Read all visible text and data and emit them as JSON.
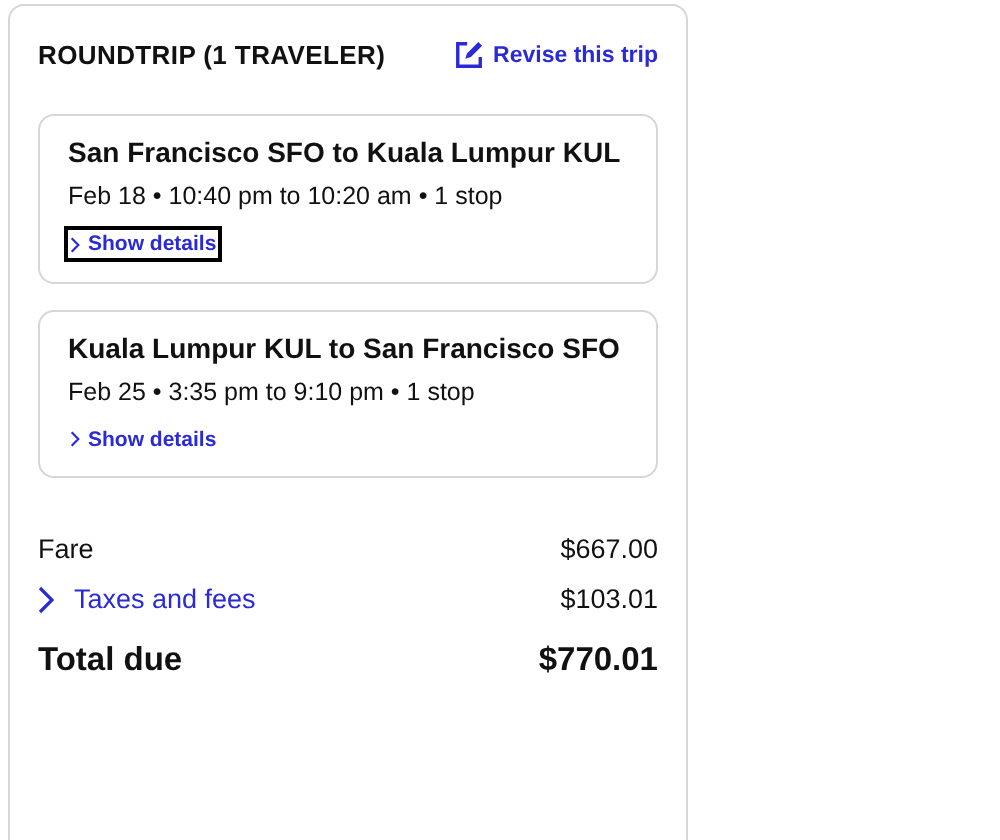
{
  "summary": {
    "title": "ROUNDTRIP (1 TRAVELER)",
    "revise_link": "Revise this trip"
  },
  "flights": [
    {
      "route": "San Francisco SFO to Kuala Lumpur KUL",
      "details": "Feb 18 • 10:40 pm to 10:20 am • 1 stop",
      "toggle": "Show details",
      "focused": true
    },
    {
      "route": "Kuala Lumpur KUL to San Francisco SFO",
      "details": "Feb 25 • 3:35 pm to 9:10 pm • 1 stop",
      "toggle": "Show details",
      "focused": false
    }
  ],
  "price_lines": [
    {
      "kind": "plain",
      "label": "Fare",
      "amount": "$667.00"
    },
    {
      "kind": "expandable",
      "label": "Taxes and fees",
      "amount": "$103.01"
    },
    {
      "kind": "total",
      "label": "Total due",
      "amount": "$770.01"
    }
  ]
}
